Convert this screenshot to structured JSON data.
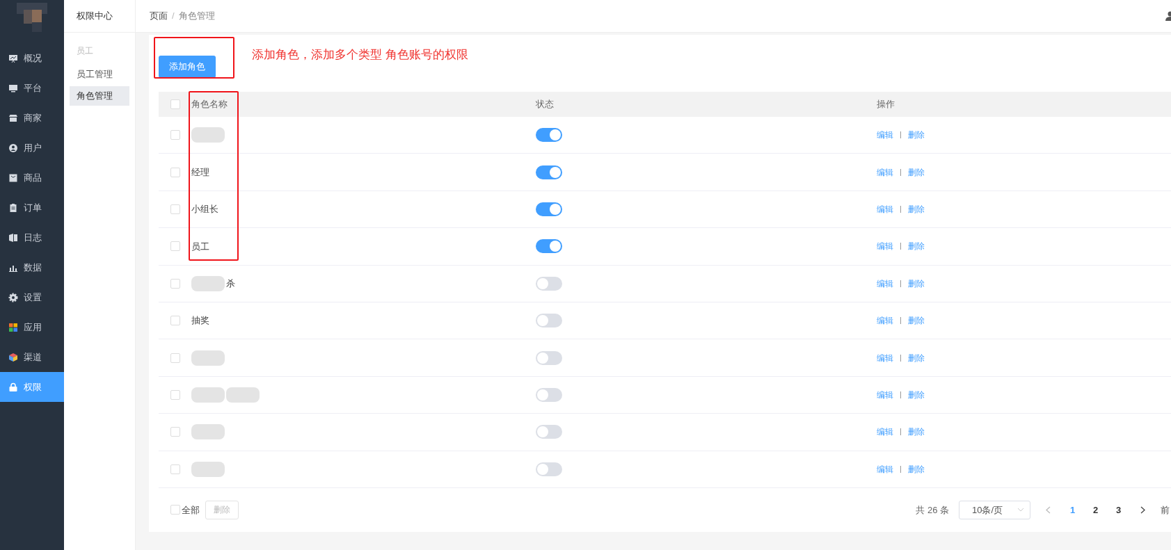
{
  "nav": [
    {
      "label": "概况",
      "selected": false
    },
    {
      "label": "平台",
      "selected": false
    },
    {
      "label": "商家",
      "selected": false
    },
    {
      "label": "用户",
      "selected": false
    },
    {
      "label": "商品",
      "selected": false
    },
    {
      "label": "订单",
      "selected": false
    },
    {
      "label": "日志",
      "selected": false
    },
    {
      "label": "数据",
      "selected": false
    },
    {
      "label": "设置",
      "selected": false
    },
    {
      "label": "应用",
      "selected": false
    },
    {
      "label": "渠道",
      "selected": false
    },
    {
      "label": "权限",
      "selected": true
    }
  ],
  "subnav": {
    "title": "权限中心",
    "group": "员工",
    "items": [
      {
        "label": "员工管理",
        "selected": false
      },
      {
        "label": "角色管理",
        "selected": true
      }
    ]
  },
  "breadcrumb": [
    "页面",
    "角色管理"
  ],
  "breadcrumb_separator": "/",
  "add_button": "添加角色",
  "annotation": "添加角色，添加多个类型 角色账号的权限",
  "table": {
    "all_checked": false,
    "columns": [
      "角色名称",
      "状态",
      "操作"
    ],
    "rows": [
      {
        "checked": false,
        "name": [
          {
            "kind": "blur"
          }
        ],
        "on": true,
        "actions": [
          "编辑",
          "删除"
        ]
      },
      {
        "checked": false,
        "name": [
          {
            "kind": "text",
            "text": "经理"
          }
        ],
        "on": true,
        "actions": [
          "编辑",
          "删除"
        ]
      },
      {
        "checked": false,
        "name": [
          {
            "kind": "text",
            "text": "小组长"
          }
        ],
        "on": true,
        "actions": [
          "编辑",
          "删除"
        ]
      },
      {
        "checked": false,
        "name": [
          {
            "kind": "text",
            "text": "员工"
          }
        ],
        "on": true,
        "actions": [
          "编辑",
          "删除"
        ]
      },
      {
        "checked": false,
        "name": [
          {
            "kind": "blur"
          },
          {
            "kind": "text",
            "text": "杀"
          }
        ],
        "on": false,
        "actions": [
          "编辑",
          "删除"
        ]
      },
      {
        "checked": false,
        "name": [
          {
            "kind": "text",
            "text": "抽奖"
          }
        ],
        "on": false,
        "actions": [
          "编辑",
          "删除"
        ]
      },
      {
        "checked": false,
        "name": [
          {
            "kind": "blur"
          }
        ],
        "on": false,
        "actions": [
          "编辑",
          "删除"
        ]
      },
      {
        "checked": false,
        "name": [
          {
            "kind": "blur"
          },
          {
            "kind": "blur"
          }
        ],
        "on": false,
        "actions": [
          "编辑",
          "删除"
        ]
      },
      {
        "checked": false,
        "name": [
          {
            "kind": "blur"
          }
        ],
        "on": false,
        "actions": [
          "编辑",
          "删除"
        ]
      },
      {
        "checked": false,
        "name": [
          {
            "kind": "blur"
          }
        ],
        "on": false,
        "actions": [
          "编辑",
          "删除"
        ]
      }
    ]
  },
  "footer": {
    "select_all_checked": false,
    "select_all": "全部",
    "delete": "删除",
    "total": "共 26 条",
    "page_size": "10条/页",
    "pages": [
      {
        "label": "1",
        "selected": true
      },
      {
        "label": "2",
        "selected": false
      },
      {
        "label": "3",
        "selected": false
      }
    ],
    "jump": "前"
  }
}
